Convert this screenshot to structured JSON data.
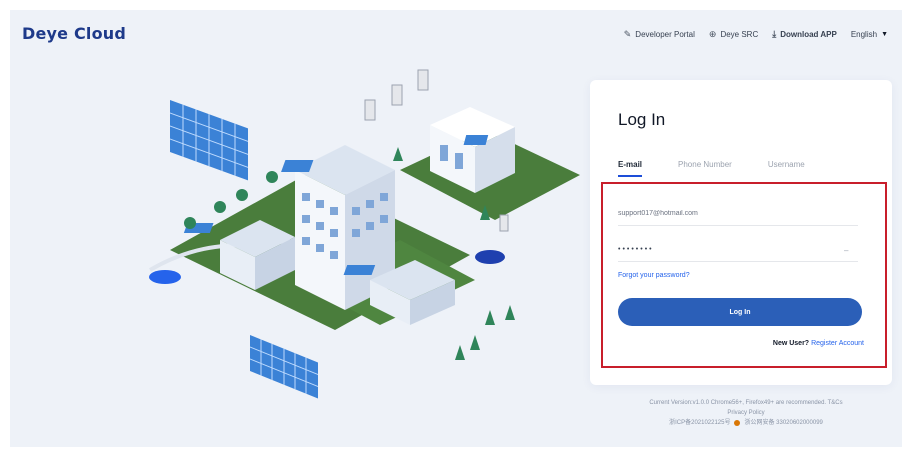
{
  "app": {
    "logo": "Deye Cloud"
  },
  "topnav": {
    "developer_portal": "Developer Portal",
    "deye_src": "Deye SRC",
    "download_app": "Download APP",
    "language": "English"
  },
  "login": {
    "title": "Log In",
    "tabs": [
      {
        "label": "E-mail",
        "active": true
      },
      {
        "label": "Phone Number",
        "active": false
      },
      {
        "label": "Username",
        "active": false
      }
    ],
    "email_value": "support017@hotmail.com",
    "password_value": "••••••••",
    "forgot_password": "Forgot your password?",
    "login_button": "Log In",
    "new_user": "New User?",
    "register": "Register Account"
  },
  "footer": {
    "version": "Current Version:v1.0.0 Chrome56+, Firefox49+ are recommended. T&Cs",
    "privacy": "Privacy Policy",
    "icp": "浙ICP备2021022125号",
    "police": "浙公网安备 33020602000099"
  },
  "colors": {
    "brand": "#1e3a8a",
    "primary_button": "#2b5fb8",
    "link": "#2563eb",
    "highlight_border": "#c81e2b",
    "page_background": "#eef2f8"
  },
  "icons": {
    "developer": "wrench-icon",
    "deye_src": "globe-icon",
    "download": "download-icon",
    "language": "chevron-down-icon",
    "password": "eye-icon"
  }
}
